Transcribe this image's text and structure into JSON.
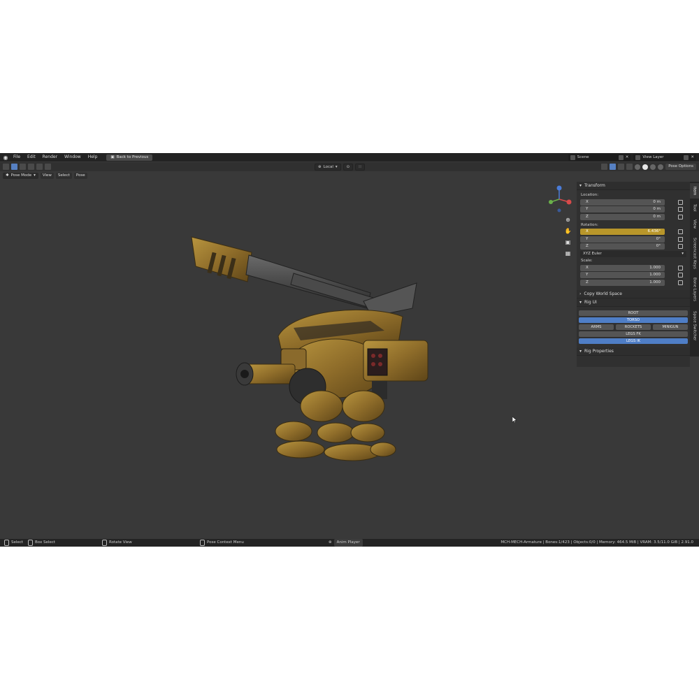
{
  "topbar": {
    "menus": [
      "File",
      "Edit",
      "Render",
      "Window",
      "Help"
    ],
    "back_button": "Back to Previous",
    "scene": "Scene",
    "view_layer": "View Layer"
  },
  "header": {
    "transform_orientation": "Local",
    "pose_options": "Pose Options"
  },
  "mode_row": {
    "mode": "Pose Mode",
    "menus": [
      "View",
      "Select",
      "Pose"
    ]
  },
  "sidebar": {
    "transform": {
      "title": "Transform",
      "location_label": "Location:",
      "location": [
        {
          "axis": "X",
          "value": "0 m"
        },
        {
          "axis": "Y",
          "value": "0 m"
        },
        {
          "axis": "Z",
          "value": "0 m"
        }
      ],
      "rotation_label": "Rotation:",
      "rotation": [
        {
          "axis": "X",
          "value": "6.436°"
        },
        {
          "axis": "Y",
          "value": "0°"
        },
        {
          "axis": "Z",
          "value": "0°"
        }
      ],
      "rotation_mode": "XYZ Euler",
      "scale_label": "Scale:",
      "scale": [
        {
          "axis": "X",
          "value": "1.000"
        },
        {
          "axis": "Y",
          "value": "1.000"
        },
        {
          "axis": "Z",
          "value": "1.000"
        }
      ]
    },
    "copy_world_space": "Copy World Space",
    "rig_ui": {
      "title": "Rig UI",
      "root": "ROOT",
      "torso": "TORSO",
      "arms": "ARMS",
      "rockets": "ROCKETS",
      "minigun": "MINIGUN",
      "legs_fk": "LEGS FK",
      "legs_ik": "LEGS IK"
    },
    "rig_properties": "Rig Properties"
  },
  "tabs": [
    "Item",
    "Tool",
    "View",
    "Screencast Keys",
    "Bone Layers",
    "Space Switcher"
  ],
  "statusbar": {
    "select": "Select",
    "box_select": "Box Select",
    "rotate_view": "Rotate View",
    "pose_context_menu": "Pose Context Menu",
    "anim_player": "Anim Player",
    "info": "MCH-MECH-Armature | Bones:1/423 | Objects:0/0 | Memory: 464.5 MiB | VRAM: 3.5/11.0 GiB | 2.91.0"
  },
  "colors": {
    "viewport_bg": "#393939",
    "accent_blue": "#4f7ec6",
    "highlight_gold": "#b8962a",
    "mech_body": "#9c7a33"
  },
  "icons": [
    "blender-logo-icon",
    "back-arrow-icon",
    "zoom-icon",
    "hand-icon",
    "camera-icon",
    "grid-icon",
    "lock-icon",
    "mouse-icon",
    "cursor-icon"
  ]
}
